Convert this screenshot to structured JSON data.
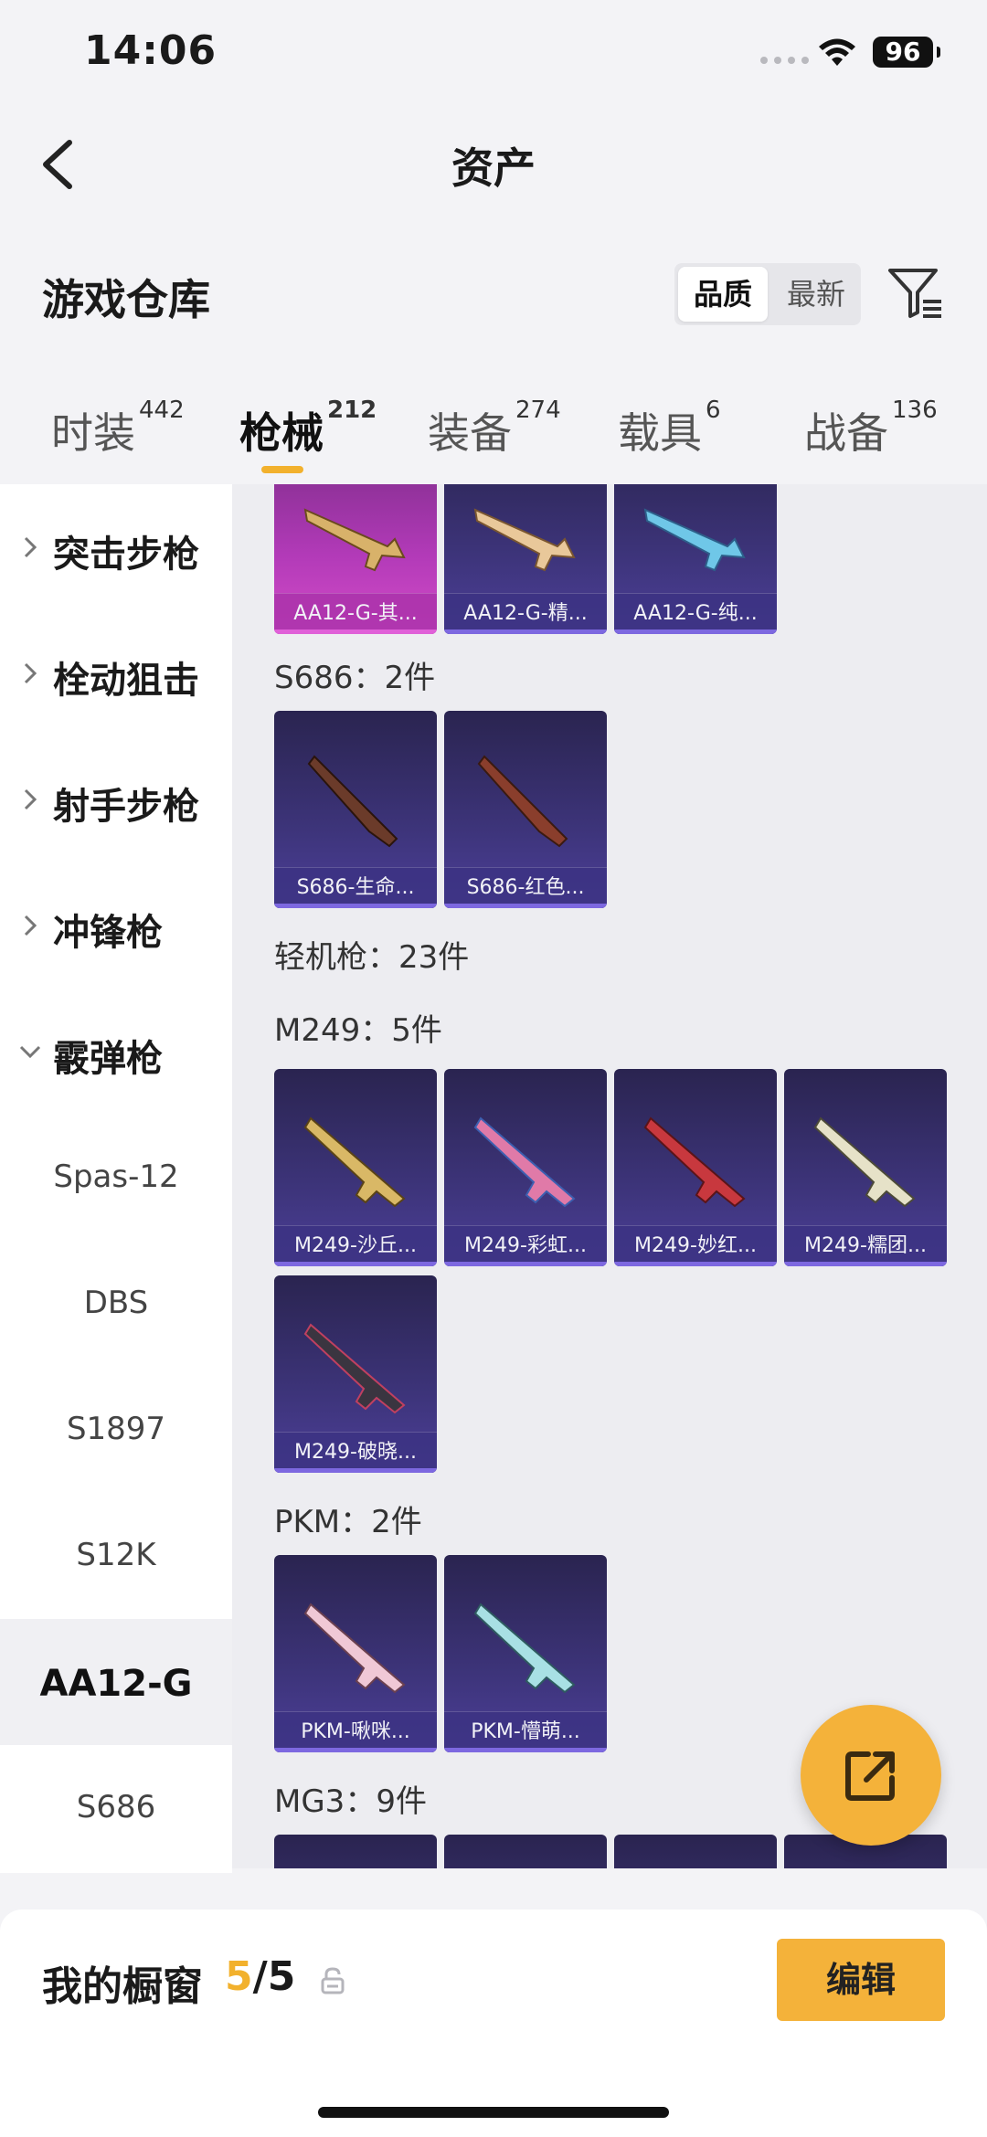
{
  "status": {
    "time": "14:06",
    "battery": "96"
  },
  "nav": {
    "title": "资产"
  },
  "header": {
    "title": "游戏仓库",
    "sort_options": [
      "品质",
      "最新"
    ]
  },
  "tabs": [
    {
      "label": "时装",
      "count": "442"
    },
    {
      "label": "枪械",
      "count": "212"
    },
    {
      "label": "装备",
      "count": "274"
    },
    {
      "label": "载具",
      "count": "6"
    },
    {
      "label": "战备",
      "count": "136"
    }
  ],
  "sidebar": {
    "categories": [
      "突击步枪",
      "栓动狙击",
      "射手步枪",
      "冲锋枪",
      "霰弹枪"
    ],
    "subitems": [
      "Spas-12",
      "DBS",
      "S1897",
      "S12K",
      "AA12-G",
      "S686"
    ]
  },
  "content": {
    "top_cards": [
      "AA12-G-其...",
      "AA12-G-精...",
      "AA12-G-纯..."
    ],
    "s686_label": "S686：2件",
    "s686_cards": [
      "S686-生命...",
      "S686-红色..."
    ],
    "lmg_label": "轻机枪：23件",
    "m249_label": "M249：5件",
    "m249_cards": [
      "M249-沙丘...",
      "M249-彩虹...",
      "M249-妙红...",
      "M249-糯团...",
      "M249-破晓..."
    ],
    "pkm_label": "PKM：2件",
    "pkm_cards": [
      "PKM-啾咪...",
      "PKM-懵萌..."
    ],
    "mg3_label": "MG3：9件"
  },
  "bottom": {
    "title": "我的橱窗",
    "current": "5",
    "total": "/5",
    "edit_label": "编辑"
  }
}
